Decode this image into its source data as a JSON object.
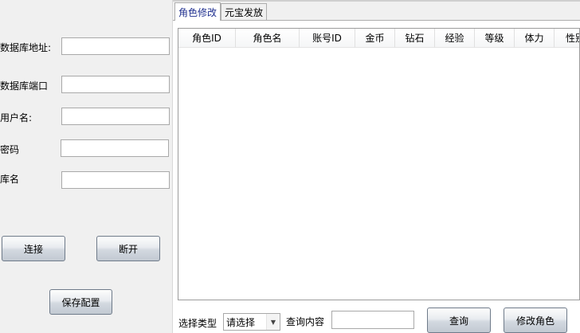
{
  "connection": {
    "db_address_label": "数据库地址:",
    "db_port_label": "数据库端口",
    "username_label": "用户名:",
    "password_label": "密码",
    "db_name_label": "库名",
    "db_address_value": "",
    "db_port_value": "",
    "username_value": "",
    "password_value": "",
    "db_name_value": "",
    "connect_label": "连接",
    "disconnect_label": "断开",
    "save_config_label": "保存配置"
  },
  "tabs": [
    {
      "label": "角色修改",
      "active": true
    },
    {
      "label": "元宝发放",
      "active": false
    }
  ],
  "grid": {
    "columns": [
      "角色ID",
      "角色名",
      "账号ID",
      "金币",
      "钻石",
      "经验",
      "等级",
      "体力",
      "性别"
    ]
  },
  "footer": {
    "select_type_label": "选择类型",
    "select_type_value": "请选择",
    "query_content_label": "查询内容",
    "query_content_value": "",
    "query_label": "查询",
    "modify_role_label": "修改角色"
  },
  "colors": {
    "accent_tab_text": "#1f2f8f",
    "window_bg": "#f0f0f0"
  }
}
